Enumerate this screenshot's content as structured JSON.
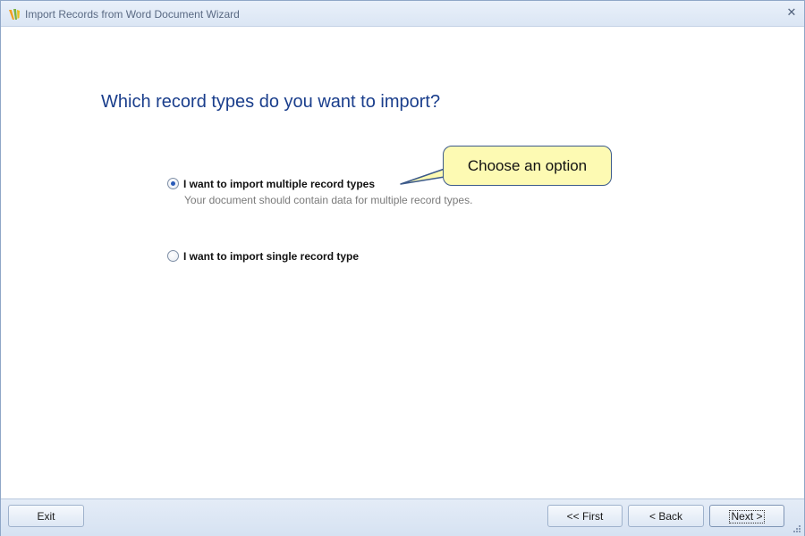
{
  "window": {
    "title": "Import Records from Word Document Wizard"
  },
  "main": {
    "heading": "Which record types do you want to import?",
    "options": [
      {
        "label": "I want to import multiple record types",
        "description": "Your document should contain data for multiple record types.",
        "selected": true
      },
      {
        "label": "I want to import single record type",
        "selected": false
      }
    ],
    "callout": "Choose an option"
  },
  "footer": {
    "exit_label": "Exit",
    "first_label": "<< First",
    "back_label": "< Back",
    "next_label": "Next >"
  },
  "icons": {
    "app": "app-icon",
    "close": "close-icon",
    "grip": "resize-grip-icon"
  },
  "colors": {
    "heading": "#1a3e8c",
    "callout_fill": "#fdfab3",
    "callout_border": "#3c5a8a",
    "footer_bg": "#dde7f4"
  }
}
